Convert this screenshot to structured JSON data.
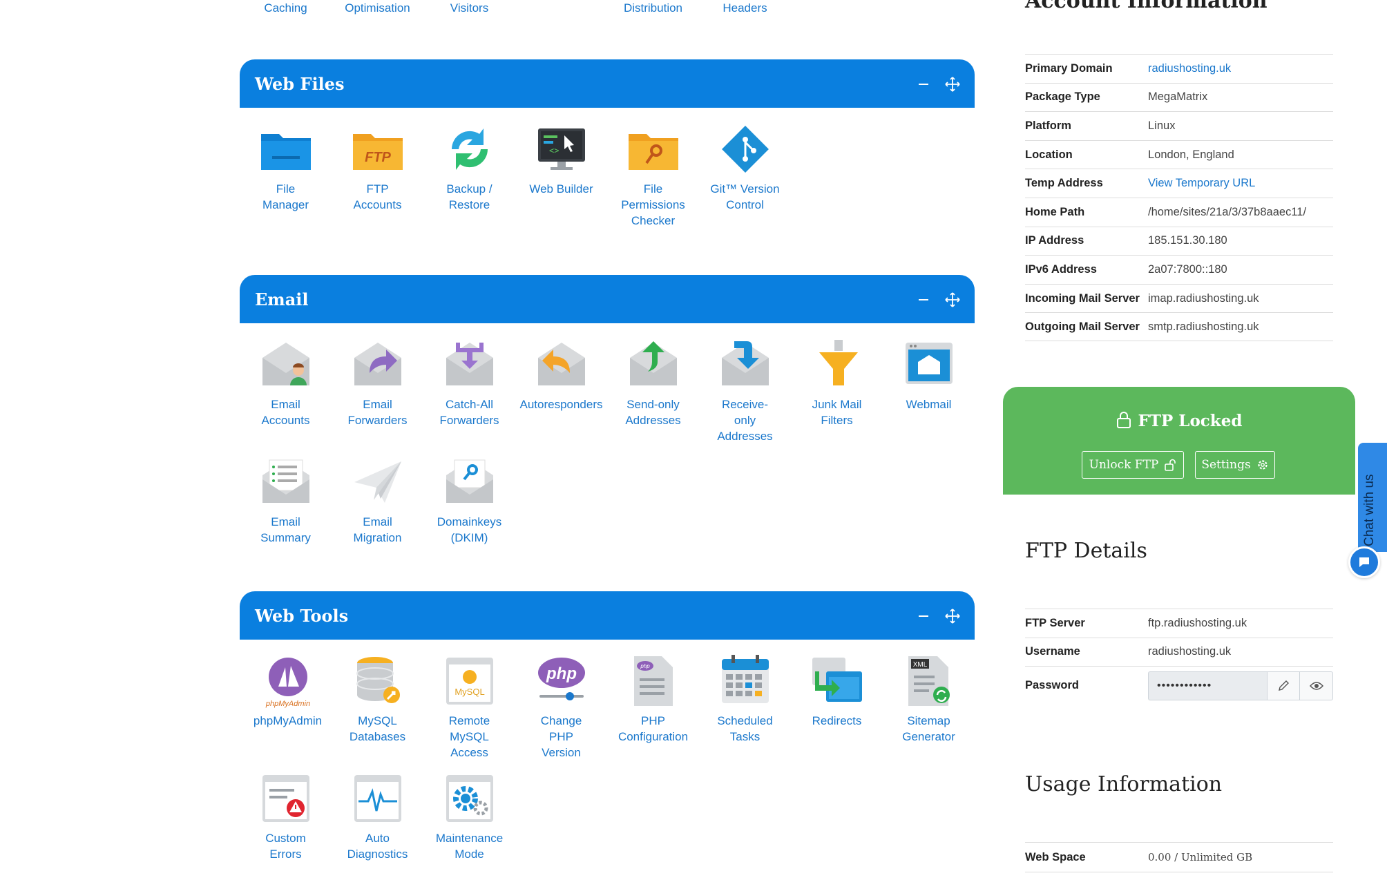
{
  "top_row": [
    "Caching",
    "Optimisation",
    "Visitors",
    "Distribution",
    "Headers"
  ],
  "web_files": {
    "title": "Web Files",
    "items": [
      {
        "label": "File\nManager",
        "icon": "folder-icon"
      },
      {
        "label": "FTP\nAccounts",
        "icon": "ftp-folder-icon"
      },
      {
        "label": "Backup /\nRestore",
        "icon": "backup-restore-icon"
      },
      {
        "label": "Web Builder",
        "icon": "web-builder-icon"
      },
      {
        "label": "File\nPermissions\nChecker",
        "icon": "file-permissions-icon"
      },
      {
        "label": "Git™ Version\nControl",
        "icon": "git-icon"
      }
    ]
  },
  "email": {
    "title": "Email",
    "items": [
      {
        "label": "Email\nAccounts",
        "icon": "email-accounts-icon"
      },
      {
        "label": "Email\nForwarders",
        "icon": "email-forwarders-icon"
      },
      {
        "label": "Catch-All\nForwarders",
        "icon": "catch-all-icon"
      },
      {
        "label": "Autoresponders",
        "icon": "autoresponders-icon"
      },
      {
        "label": "Send-only\nAddresses",
        "icon": "send-only-icon"
      },
      {
        "label": "Receive-\nonly\nAddresses",
        "icon": "receive-only-icon"
      },
      {
        "label": "Junk Mail\nFilters",
        "icon": "junk-filter-icon"
      },
      {
        "label": "Webmail",
        "icon": "webmail-icon"
      },
      {
        "label": "Email\nSummary",
        "icon": "email-summary-icon"
      },
      {
        "label": "Email\nMigration",
        "icon": "paper-plane-icon"
      },
      {
        "label": "Domainkeys\n(DKIM)",
        "icon": "dkim-key-icon"
      }
    ]
  },
  "web_tools": {
    "title": "Web Tools",
    "items": [
      {
        "label": "phpMyAdmin",
        "icon": "phpmyadmin-icon"
      },
      {
        "label": "MySQL\nDatabases",
        "icon": "database-icon"
      },
      {
        "label": "Remote\nMySQL\nAccess",
        "icon": "remote-mysql-icon"
      },
      {
        "label": "Change\nPHP\nVersion",
        "icon": "php-version-icon"
      },
      {
        "label": "PHP\nConfiguration",
        "icon": "php-config-icon"
      },
      {
        "label": "Scheduled\nTasks",
        "icon": "calendar-icon"
      },
      {
        "label": "Redirects",
        "icon": "redirects-icon"
      },
      {
        "label": "Sitemap\nGenerator",
        "icon": "sitemap-icon"
      },
      {
        "label": "Custom\nErrors",
        "icon": "custom-errors-icon"
      },
      {
        "label": "Auto\nDiagnostics",
        "icon": "diagnostics-icon"
      },
      {
        "label": "Maintenance\nMode",
        "icon": "gear-icon"
      }
    ]
  },
  "account": {
    "title": "Account Information",
    "rows": [
      {
        "key": "Primary Domain",
        "value": "radiushosting.uk",
        "link": true
      },
      {
        "key": "Package Type",
        "value": "MegaMatrix",
        "link": false
      },
      {
        "key": "Platform",
        "value": "Linux",
        "link": false
      },
      {
        "key": "Location",
        "value": "London, England",
        "link": false
      },
      {
        "key": "Temp Address",
        "value": "View Temporary URL",
        "link": true
      },
      {
        "key": "Home Path",
        "value": "/home/sites/21a/3/37b8aaec11/",
        "link": false
      },
      {
        "key": "IP Address",
        "value": "185.151.30.180",
        "link": false
      },
      {
        "key": "IPv6 Address",
        "value": "2a07:7800::180",
        "link": false
      },
      {
        "key": "Incoming Mail Server",
        "value": "imap.radiushosting.uk",
        "link": false
      },
      {
        "key": "Outgoing Mail Server",
        "value": "smtp.radiushosting.uk",
        "link": false
      }
    ]
  },
  "ftp_lock": {
    "title": "FTP Locked",
    "unlock_label": "Unlock FTP",
    "settings_label": "Settings"
  },
  "ftp_details": {
    "title": "FTP Details",
    "server_key": "FTP Server",
    "server_value": "ftp.radiushosting.uk",
    "username_key": "Username",
    "username_value": "radiushosting.uk",
    "password_key": "Password",
    "password_value": "••••••••••••"
  },
  "usage": {
    "title": "Usage Information",
    "web_space_key": "Web Space",
    "web_space_value": "0.00 / Unlimited GB"
  },
  "chat": {
    "label": "Chat with us"
  },
  "colors": {
    "header_blue": "#0a7fdf",
    "link_blue": "#1b78cc",
    "ftp_green": "#5cb85c"
  }
}
